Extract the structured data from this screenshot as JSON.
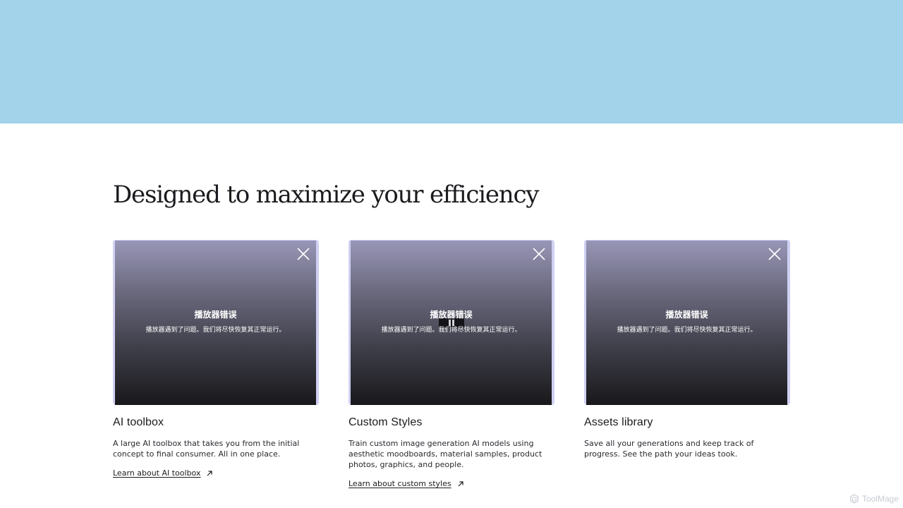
{
  "section": {
    "title": "Designed to maximize your efficiency"
  },
  "cards": [
    {
      "player_error_title": "播放器错误",
      "player_error_message": "播放器遇到了问题。我们将尽快恢复其正常运行。",
      "title": "AI toolbox",
      "description": "A large AI toolbox that takes you from the initial concept to final consumer. All in one place.",
      "link": "Learn about AI toolbox"
    },
    {
      "player_error_title": "播放器错误",
      "player_error_message": "播放器遇到了问题。我们将尽快恢复其正常运行。",
      "title": "Custom Styles",
      "description": "Train custom image generation AI models using aesthetic moodboards, material samples, product photos, graphics, and people.",
      "link": "Learn about custom styles"
    },
    {
      "player_error_title": "播放器错误",
      "player_error_message": "播放器遇到了问题。我们将尽快恢复其正常运行。",
      "title": "Assets library",
      "description": "Save all your generations and keep track of progress. See the path your ideas took.",
      "link": ""
    }
  ],
  "watermark": {
    "text": "ToolMage"
  },
  "icons": {
    "close": "close-icon",
    "link_arrow": "arrow-up-right-icon"
  },
  "colors": {
    "hero_band": "#a2d3eb",
    "card_frame": "#cfd0f2"
  }
}
